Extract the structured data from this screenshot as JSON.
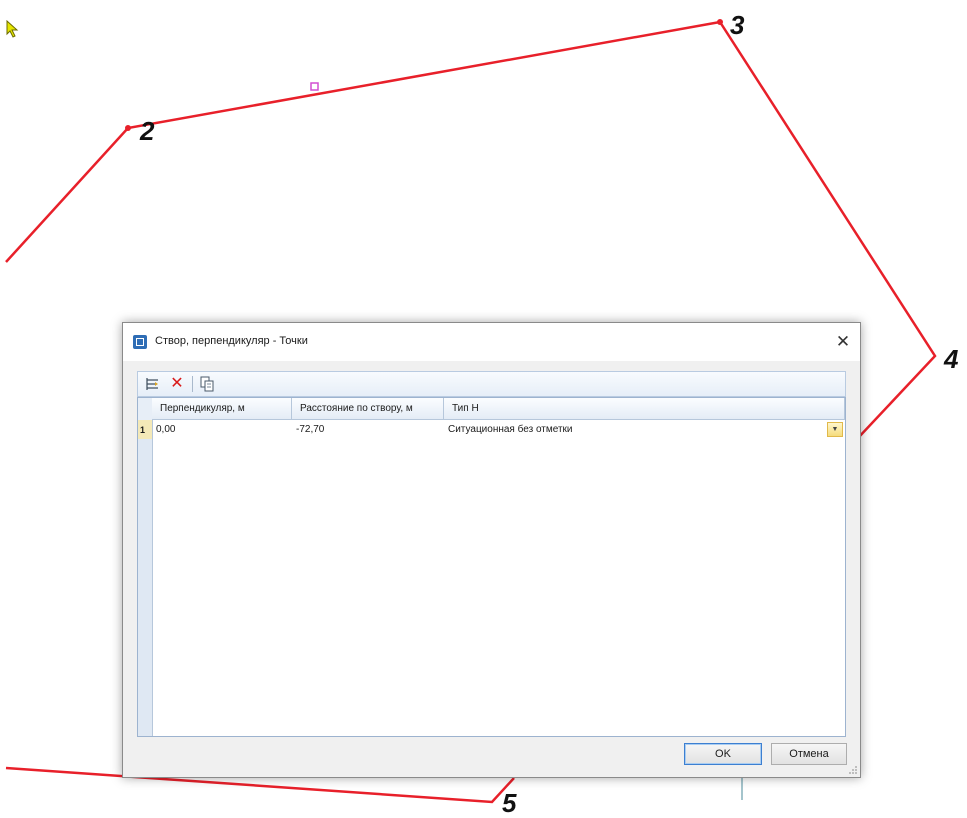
{
  "canvas": {
    "polyline_color": "#e8202a",
    "vertex_labels": [
      "2",
      "3",
      "4",
      "5"
    ]
  },
  "dialog": {
    "title": "Створ, перпендикуляр - Точки",
    "close_glyph": "✕",
    "toolbar": {
      "icons": [
        "add-point-icon",
        "delete-icon",
        "copy-icon"
      ],
      "delete_glyph": "✕"
    },
    "grid": {
      "columns": [
        "Перпендикуляр, м",
        "Расстояние по створу, м",
        "Тип Н"
      ],
      "rows": [
        {
          "num": "1",
          "values": [
            "0,00",
            "-72,70",
            "Ситуационная без отметки"
          ]
        }
      ],
      "dropdown_glyph": "▼"
    },
    "buttons": {
      "ok": "OK",
      "cancel": "Отмена"
    }
  }
}
